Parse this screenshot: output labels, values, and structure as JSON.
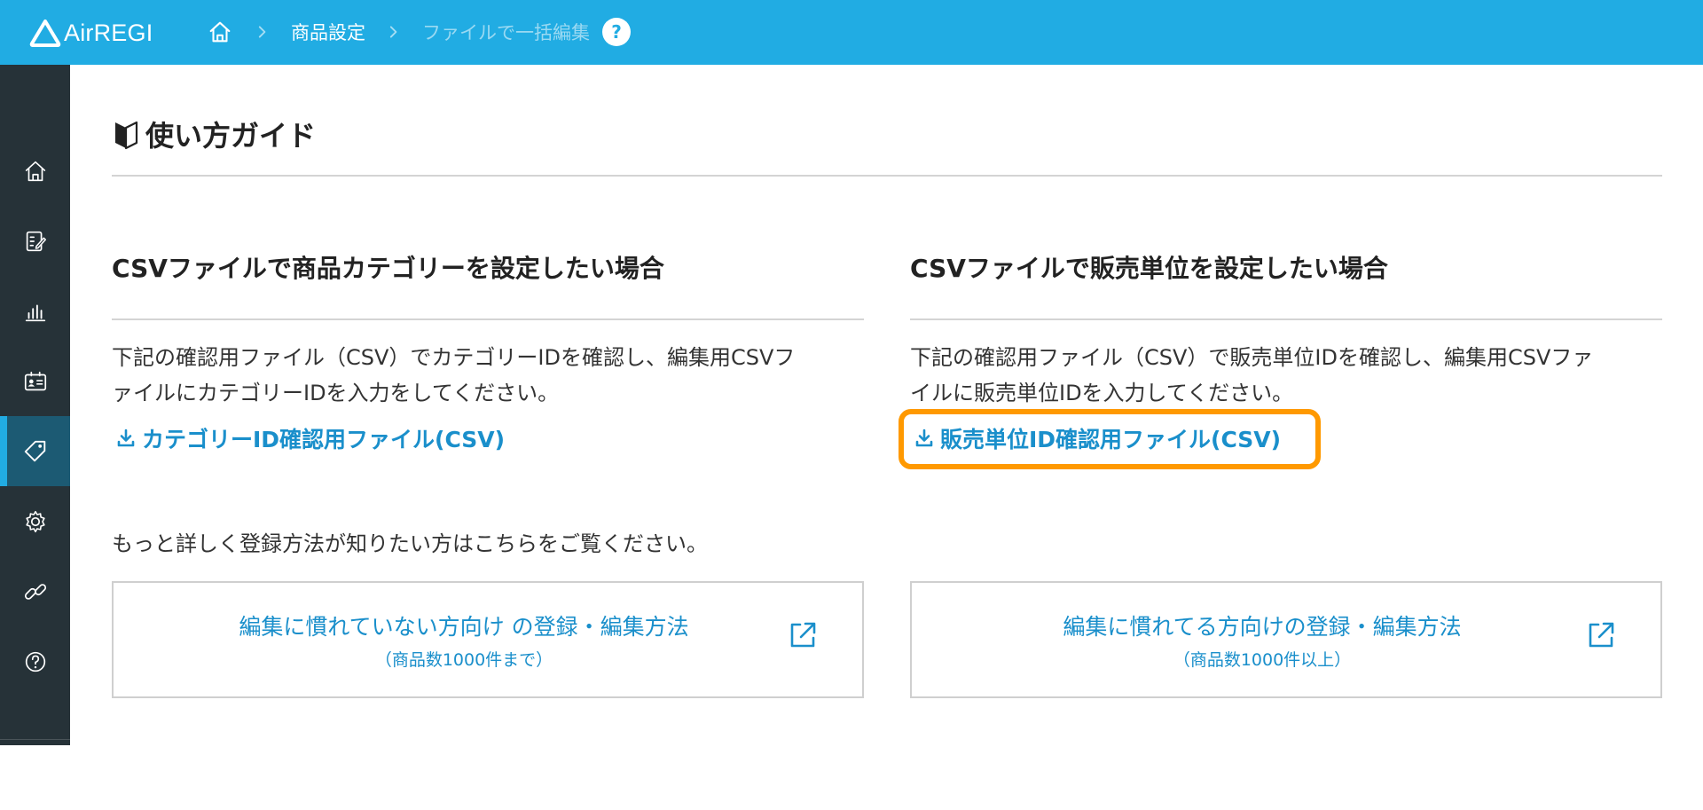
{
  "colors": {
    "header_bg": "#21ace3",
    "sidebar_bg": "#263238",
    "link": "#1a8fcb",
    "highlight": "#ff9900"
  },
  "header": {
    "brand": "AirREGI",
    "breadcrumb": {
      "home_icon": "home-icon",
      "items": [
        "商品設定",
        "ファイルで一括編集"
      ],
      "help_label": "?"
    }
  },
  "sidebar": {
    "items": [
      {
        "icon": "home-icon"
      },
      {
        "icon": "memo-edit-icon"
      },
      {
        "icon": "bar-chart-icon"
      },
      {
        "icon": "id-card-icon"
      },
      {
        "icon": "tag-icon",
        "active": true
      },
      {
        "icon": "gear-icon"
      },
      {
        "icon": "link-icon"
      },
      {
        "icon": "help-circle-icon"
      }
    ],
    "expand_icon": "double-chevron-right-icon"
  },
  "main": {
    "guide_title": "使い方ガイド",
    "left": {
      "title": "CSVファイルで商品カテゴリーを設定したい場合",
      "desc_line1": "下記の確認用ファイル（CSV）でカテゴリーIDを確認し、編集用CSVフ",
      "desc_line2": "ァイルにカテゴリーIDを入力をしてください。",
      "download_label": "カテゴリーID確認用ファイル(CSV)"
    },
    "right": {
      "title": "CSVファイルで販売単位を設定したい場合",
      "desc_line1": "下記の確認用ファイル（CSV）で販売単位IDを確認し、編集用CSVファ",
      "desc_line2": "イルに販売単位IDを入力してください。",
      "download_label": "販売単位ID確認用ファイル(CSV)"
    },
    "more_text": "もっと詳しく登録方法が知りたい方はこちらをご覧ください。",
    "cards": [
      {
        "main": "編集に慣れていない方向け の登録・編集方法",
        "sub": "（商品数1000件まで）"
      },
      {
        "main": "編集に慣れてる方向けの登録・編集方法",
        "sub": "（商品数1000件以上）"
      }
    ]
  }
}
